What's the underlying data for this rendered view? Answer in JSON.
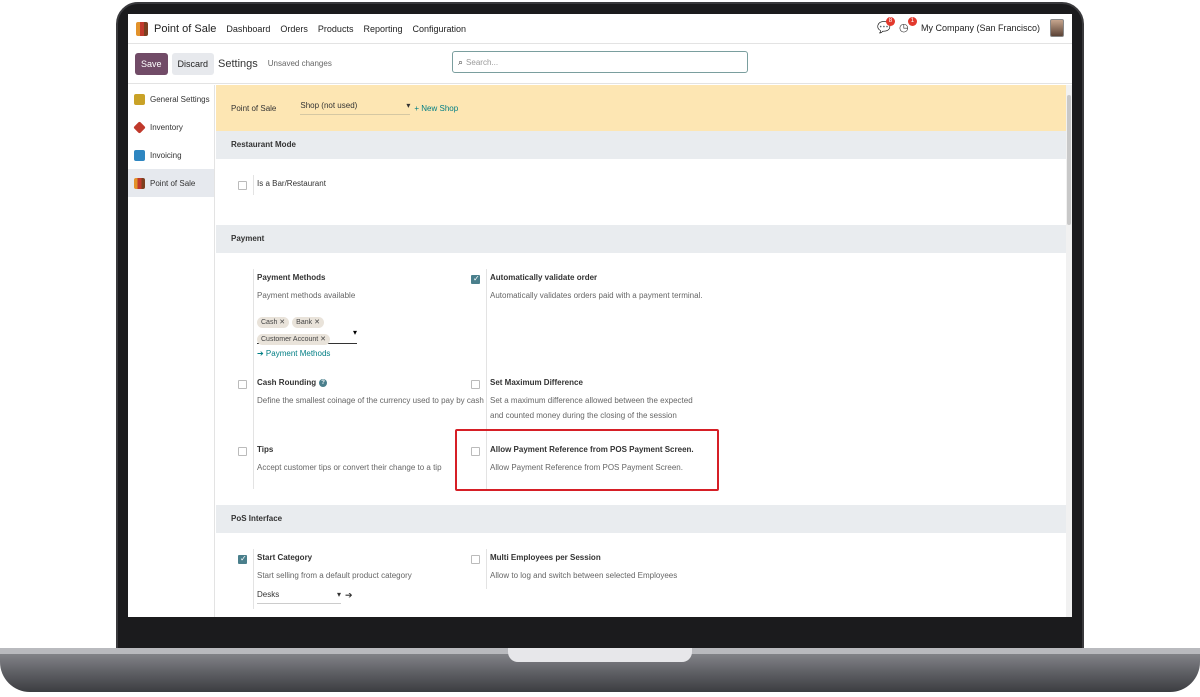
{
  "navbar": {
    "app_name": "Point of Sale",
    "menu": [
      "Dashboard",
      "Orders",
      "Products",
      "Reporting",
      "Configuration"
    ],
    "messages_badge": "8",
    "activities_badge": "1",
    "company": "My Company (San Francisco)"
  },
  "control_panel": {
    "save": "Save",
    "discard": "Discard",
    "title": "Settings",
    "unsaved": "Unsaved changes",
    "search_placeholder": "Search..."
  },
  "sidebar": {
    "items": [
      {
        "label": "General Settings",
        "color": "#c9a227"
      },
      {
        "label": "Inventory",
        "color": "#c0392b"
      },
      {
        "label": "Invoicing",
        "color": "#2e86c1"
      },
      {
        "label": "Point of Sale",
        "color": "#b3541e"
      }
    ]
  },
  "pos_bar": {
    "label": "Point of Sale",
    "shop": "Shop (not used)",
    "new_shop": "+ New Shop"
  },
  "restaurant": {
    "header": "Restaurant Mode",
    "bar_restaurant": "Is a Bar/Restaurant"
  },
  "payment": {
    "header": "Payment",
    "methods_title": "Payment Methods",
    "methods_desc": "Payment methods available",
    "tags": [
      "Cash",
      "Bank",
      "Customer Account"
    ],
    "methods_link": "➔ Payment Methods",
    "auto_validate_title": "Automatically validate order",
    "auto_validate_desc": "Automatically validates orders paid with a payment terminal.",
    "rounding_title": "Cash Rounding",
    "rounding_desc": "Define the smallest coinage of the currency used to pay by cash",
    "maxdiff_title": "Set Maximum Difference",
    "maxdiff_desc": "Set a maximum difference allowed between the expected and counted money during the closing of the session",
    "tips_title": "Tips",
    "tips_desc": "Accept customer tips or convert their change to a tip",
    "payref_title": "Allow Payment Reference from POS Payment Screen.",
    "payref_desc": "Allow Payment Reference from POS Payment Screen."
  },
  "interface": {
    "header": "PoS Interface",
    "start_cat_title": "Start Category",
    "start_cat_desc": "Start selling from a default product category",
    "start_cat_value": "Desks",
    "multi_emp_title": "Multi Employees per Session",
    "multi_emp_desc": "Allow to log and switch between selected Employees"
  }
}
